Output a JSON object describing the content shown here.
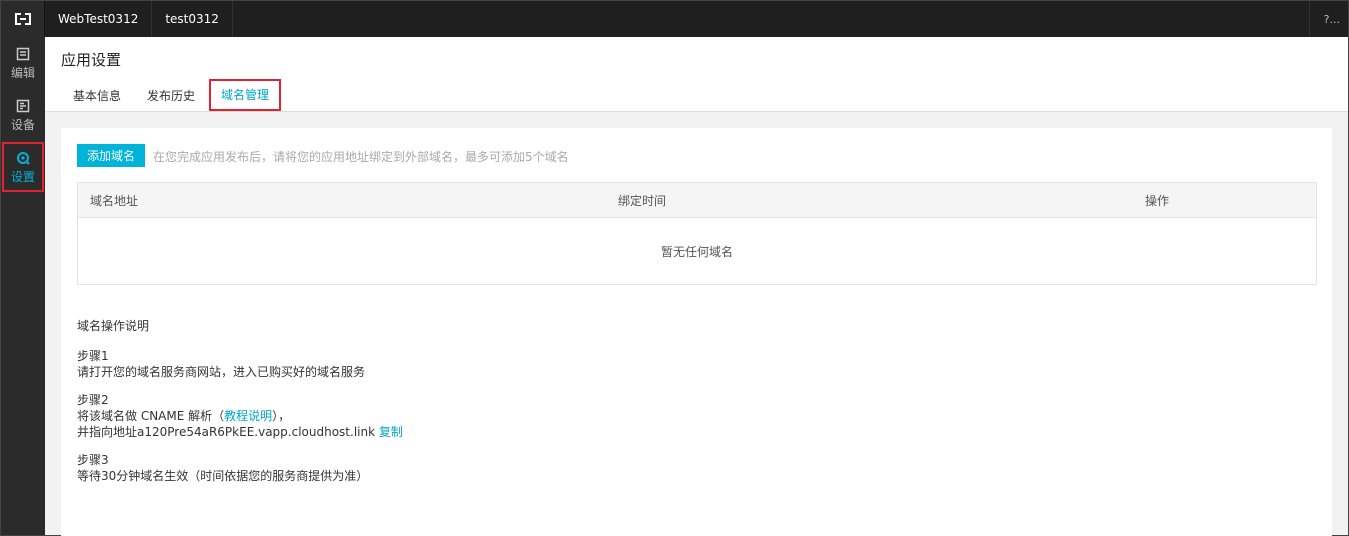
{
  "topbar": {
    "app_name": "WebTest0312",
    "env_name": "test0312",
    "help_text": "?..."
  },
  "sidebar": {
    "items": [
      {
        "label": "编辑",
        "icon": "edit-icon"
      },
      {
        "label": "设备",
        "icon": "device-icon"
      },
      {
        "label": "设置",
        "icon": "settings-icon"
      }
    ]
  },
  "header": {
    "title": "应用设置",
    "tabs": [
      {
        "label": "基本信息"
      },
      {
        "label": "发布历史"
      },
      {
        "label": "域名管理"
      }
    ]
  },
  "domain": {
    "add_button": "添加域名",
    "hint": "在您完成应用发布后，请将您的应用地址绑定到外部域名，最多可添加5个域名",
    "table": {
      "columns": [
        "域名地址",
        "绑定时间",
        "操作"
      ],
      "empty_text": "暂无任何域名"
    },
    "guide": {
      "title": "域名操作说明",
      "step1_title": "步骤1",
      "step1_text": "请打开您的域名服务商网站，进入已购买好的域名服务",
      "step2_title": "步骤2",
      "step2_prefix": "将该域名做 CNAME 解析（",
      "step2_link": "教程说明",
      "step2_suffix": "），",
      "step2_line2": "并指向地址a120Pre54aR6PkEE.vapp.cloudhost.link",
      "step2_copy": "复制",
      "step3_title": "步骤3",
      "step3_text": "等待30分钟域名生效（时间依据您的服务商提供为准）"
    }
  },
  "colors": {
    "accent": "#00b4d9",
    "highlight_border": "#e0242f",
    "topbar_bg": "#1f1f1f",
    "sidebar_bg": "#2b2b2b"
  }
}
